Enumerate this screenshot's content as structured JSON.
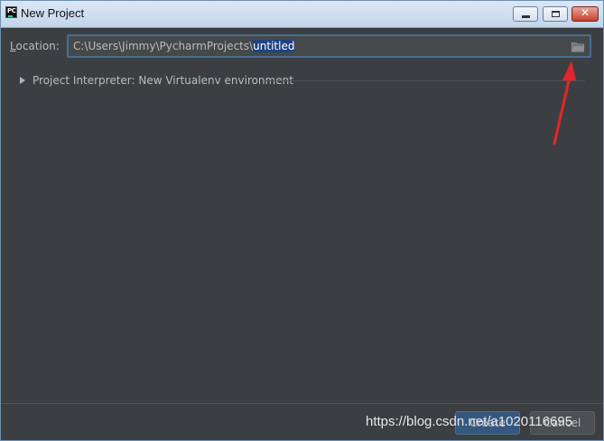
{
  "window": {
    "title": "New Project",
    "app_icon_text": "PC",
    "controls": {
      "minimize": "minimize",
      "maximize": "maximize",
      "close": "✕"
    }
  },
  "location": {
    "label_mnemonic": "L",
    "label_rest": "ocation:",
    "path_prefix": "C:\\Users\\Jimmy\\PycharmProjects\\",
    "path_selected": "untitled",
    "browse_icon": "folder-icon"
  },
  "interpreter": {
    "expand_icon": "triangle-right-icon",
    "label": "Project Interpreter: New Virtualenv environment"
  },
  "footer": {
    "create_label": "Create",
    "cancel_label": "Cancel"
  },
  "watermark": "https://blog.csdn.net/a1020116695",
  "colors": {
    "background": "#3c3f41",
    "field_border": "#466d94",
    "selection": "#214283",
    "annotation_arrow": "#e3262b"
  }
}
